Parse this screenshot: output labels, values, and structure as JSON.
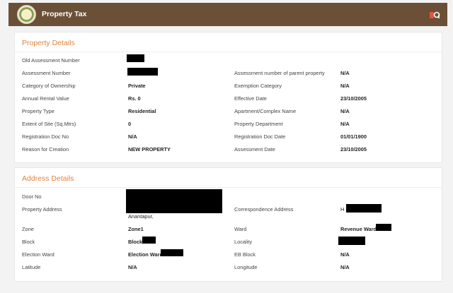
{
  "header": {
    "title": "Property Tax"
  },
  "property_details": {
    "heading": "Property Details",
    "fields": [
      {
        "label": "Old Assessment Number",
        "value": ""
      },
      {
        "label": "Assessment Number",
        "value": ""
      },
      {
        "label": "Category of Ownership",
        "value": "Private"
      },
      {
        "label": "Annual Rental Value",
        "value": "Rs. 0"
      },
      {
        "label": "Property Type",
        "value": "Residential"
      },
      {
        "label": "Extent of Site (Sq.Mtrs)",
        "value": "0"
      },
      {
        "label": "Registration Doc No",
        "value": "N/A"
      },
      {
        "label": "Reason for Creation",
        "value": "NEW PROPERTY"
      }
    ],
    "right_fields": [
      {
        "label": "Assessment number of parent property",
        "value": "N/A"
      },
      {
        "label": "Exemption Category",
        "value": "N/A"
      },
      {
        "label": "Effective Date",
        "value": "23/10/2005"
      },
      {
        "label": "Apartment/Complex Name",
        "value": "N/A"
      },
      {
        "label": "Property Department",
        "value": "N/A"
      },
      {
        "label": "Registration Doc Date",
        "value": "01/01/1900"
      },
      {
        "label": "Assessment Date",
        "value": "23/10/2005"
      }
    ]
  },
  "address_details": {
    "heading": "Address Details",
    "door_no_label": "Door No",
    "property_address_label": "Property Address",
    "property_address_value": "Anantapur,",
    "correspondence_label": "Correspondence Address",
    "correspondence_value": "H",
    "zone_label": "Zone",
    "zone_value": "Zone1",
    "ward_label": "Ward",
    "ward_value": "Revenue Ward",
    "block_label": "Block",
    "block_value": "Block",
    "locality_label": "Locality",
    "locality_value": "",
    "election_ward_label": "Election Ward",
    "election_ward_value": "Election Ward",
    "eb_block_label": "EB Block",
    "eb_block_value": "N/A",
    "latitude_label": "Latitude",
    "latitude_value": "N/A",
    "longitude_label": "Longitude",
    "longitude_value": "N/A"
  }
}
